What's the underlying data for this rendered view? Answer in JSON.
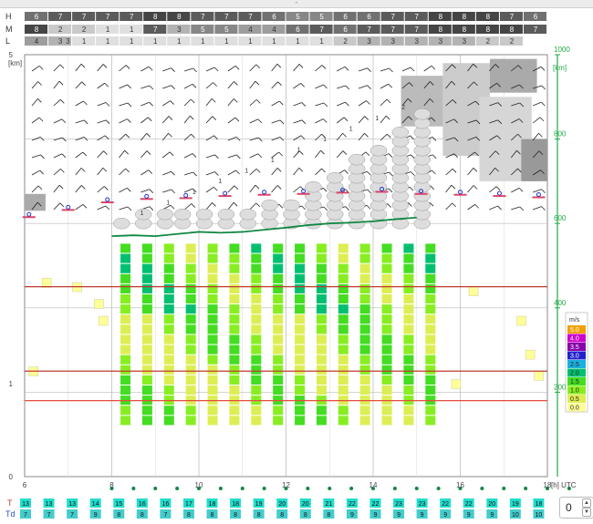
{
  "controls": {
    "offset_value": "0"
  },
  "chart_data": {
    "type": "meteogram",
    "x_label": "[h] UTC",
    "x_ticks": [
      6,
      8,
      10,
      12,
      14,
      16,
      18
    ],
    "x_range": [
      6,
      18
    ],
    "y_label_left": "[km]",
    "y_ticks_left": [
      0,
      1,
      5
    ],
    "y_label_right": "[km]",
    "y_ticks_right": [
      200,
      400,
      600,
      800,
      1000
    ],
    "y_range_right": [
      0,
      1000
    ],
    "cloud_cover_rows": {
      "labels": [
        "H",
        "M",
        "L"
      ],
      "H": [
        "6",
        "7",
        "7",
        "7",
        "7",
        "8",
        "8",
        "7",
        "7",
        "7",
        "6",
        "5",
        "5",
        "6",
        "6",
        "7",
        "7",
        "8",
        "8",
        "8",
        "7",
        "6"
      ],
      "M": [
        "8",
        "2",
        "2",
        "1",
        "1",
        "7",
        "3",
        "5",
        "5",
        "4",
        "4",
        "6",
        "7",
        "6",
        "7",
        "7",
        "7",
        "8",
        "8",
        "8",
        "8",
        "7"
      ],
      "L": [
        "4",
        "3",
        "1",
        "1",
        "1",
        "1",
        "1",
        "1",
        "1",
        "1",
        "1",
        "1",
        "1",
        "2",
        "3",
        "3",
        "3",
        "3",
        "3",
        "2",
        "2",
        ""
      ],
      "L_extra": "3"
    },
    "cloud_numbers": [
      "1",
      "1",
      "1",
      "1",
      "1",
      "1",
      "1",
      "1",
      "1",
      "1",
      "2"
    ],
    "lcl_heights": [
      615,
      632,
      650,
      658,
      660,
      665,
      668,
      670,
      673,
      675,
      670,
      668,
      665,
      662
    ],
    "cloud_base_line": [
      570,
      572,
      570,
      575,
      580,
      578,
      580,
      585,
      590,
      596,
      600,
      602,
      605,
      610,
      614
    ],
    "inversion_lines": [
      {
        "color": "#c0392b",
        "y": 0.55
      },
      {
        "color": "#c0392b",
        "y": 0.75
      },
      {
        "color": "#e74c3c",
        "y": 0.82
      }
    ],
    "speed_legend": {
      "unit": "m/s",
      "entries": [
        {
          "label": "5.0",
          "color": "#f0a000"
        },
        {
          "label": "4.0",
          "color": "#cc00cc"
        },
        {
          "label": "3.5",
          "color": "#8800aa"
        },
        {
          "label": "3.0",
          "color": "#2222cc"
        },
        {
          "label": "2.5",
          "color": "#1ab0e0"
        },
        {
          "label": "2.0",
          "color": "#00c070"
        },
        {
          "label": "1.5",
          "color": "#44dd22"
        },
        {
          "label": "1.0",
          "color": "#88ee22"
        },
        {
          "label": "0.5",
          "color": "#ddee55"
        },
        {
          "label": "0.0",
          "color": "#ffff99"
        }
      ]
    },
    "T_label": "T",
    "Td_label": "Td",
    "T": [
      "13",
      "13",
      "13",
      "14",
      "15",
      "16",
      "16",
      "17",
      "18",
      "18",
      "19",
      "20",
      "20",
      "21",
      "22",
      "22",
      "23",
      "23",
      "22",
      "22",
      "20",
      "19",
      "18"
    ],
    "Td": [
      "7",
      "7",
      "7",
      "9",
      "8",
      "8",
      "7",
      "8",
      "8",
      "8",
      "8",
      "8",
      "8",
      "8",
      "9",
      "9",
      "9",
      "9",
      "9",
      "9",
      "9",
      "10",
      "10"
    ],
    "colors": {
      "axis_green": "#22aa44",
      "grid": "#999999",
      "cloud_gray": "#c8c8c8",
      "temp_box": "#22ddcc",
      "dew_box": "#44cccc"
    }
  }
}
